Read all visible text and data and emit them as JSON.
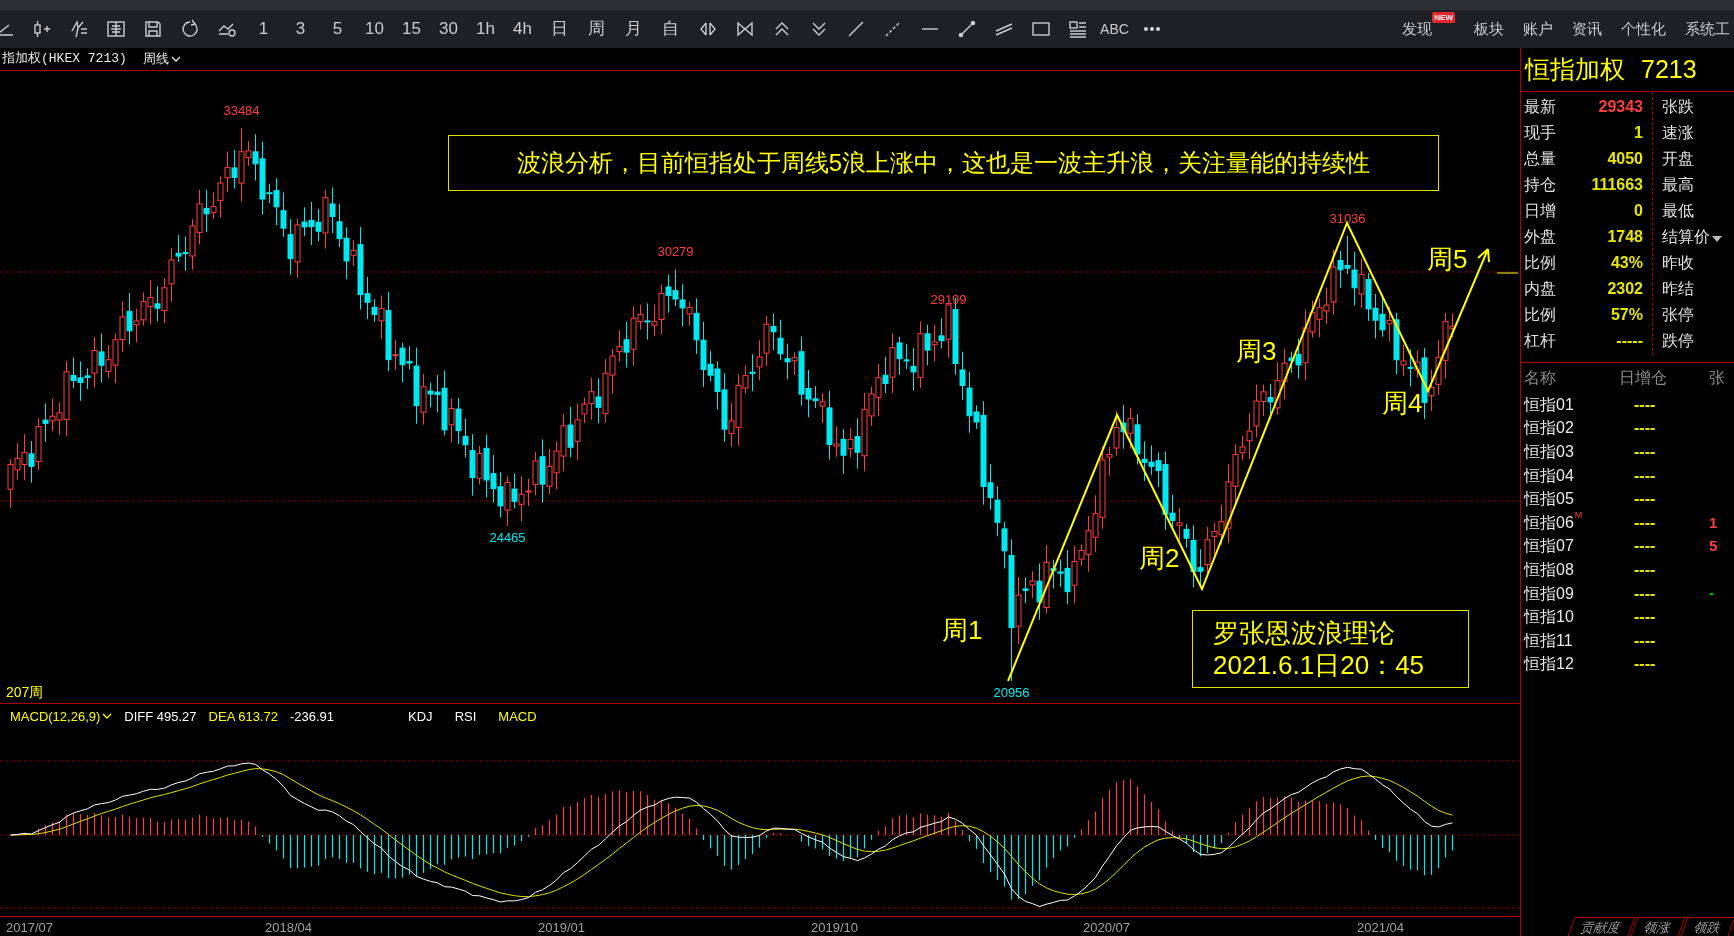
{
  "toolbar": {
    "periods": [
      {
        "label": "1",
        "selected": false
      },
      {
        "label": "3",
        "selected": false
      },
      {
        "label": "5",
        "selected": false
      },
      {
        "label": "10",
        "selected": false
      },
      {
        "label": "15",
        "selected": false
      },
      {
        "label": "30",
        "selected": false
      },
      {
        "label": "1h",
        "selected": false
      },
      {
        "label": "4h",
        "selected": false
      },
      {
        "label": "日",
        "selected": false
      },
      {
        "label": "周",
        "selected": false
      },
      {
        "label": "月",
        "selected": false
      },
      {
        "label": "自",
        "selected": false
      }
    ],
    "text_tool": "ABC",
    "nav": [
      {
        "label": "发现",
        "badge": "NEW"
      },
      {
        "label": "板块"
      },
      {
        "label": "账户"
      },
      {
        "label": "资讯"
      },
      {
        "label": "个性化"
      },
      {
        "label": "系统工"
      }
    ]
  },
  "chart_header": {
    "symbol": "指加权(HKEX 7213)",
    "period": "周线"
  },
  "main_chart": {
    "banner": "波浪分析，目前恒指处于周线5浪上涨中，这也是一波主升浪，关注量能的持续性",
    "price_labels": [
      {
        "text": "33484",
        "kind": "high"
      },
      {
        "text": "24465",
        "kind": "low"
      },
      {
        "text": "30279",
        "kind": "high"
      },
      {
        "text": "29199",
        "kind": "high"
      },
      {
        "text": "20956",
        "kind": "low"
      },
      {
        "text": "31036",
        "kind": "high"
      }
    ],
    "wave_labels": [
      "周1",
      "周2",
      "周3",
      "周4",
      "周5"
    ],
    "note": [
      "罗张恩波浪理论",
      "2021.6.1日20：45"
    ],
    "bar_count": "207周"
  },
  "macd_pane": {
    "name": "MACD(12,26,9)",
    "diff": "DIFF 495.27",
    "dea": "DEA 613.72",
    "macd": "-236.91",
    "indicators": [
      {
        "label": "KDJ",
        "selected": false
      },
      {
        "label": "RSI",
        "selected": false
      },
      {
        "label": "MACD",
        "selected": true
      }
    ]
  },
  "date_axis": [
    "2017/07",
    "2018/04",
    "2019/01",
    "2019/10",
    "2020/07",
    "2021/04"
  ],
  "quote_panel": {
    "title": "恒指加权",
    "code": "7213",
    "rows": [
      {
        "label": "最新",
        "value": "29343",
        "kind": "price",
        "right_label": "张跌"
      },
      {
        "label": "现手",
        "value": "1",
        "kind": "plain",
        "right_label": "速涨"
      },
      {
        "label": "总量",
        "value": "4050",
        "kind": "plain",
        "right_label": "开盘"
      },
      {
        "label": "持仓",
        "value": "111663",
        "kind": "plain",
        "right_label": "最高"
      },
      {
        "label": "日增",
        "value": "0",
        "kind": "plain",
        "right_label": "最低"
      },
      {
        "label": "外盘",
        "value": "1748",
        "kind": "plain",
        "right_label": "结算价"
      },
      {
        "label": "比例",
        "value": "43%",
        "kind": "plain",
        "right_label": "昨收"
      },
      {
        "label": "内盘",
        "value": "2302",
        "kind": "plain",
        "right_label": "昨结"
      },
      {
        "label": "比例",
        "value": "57%",
        "kind": "plain",
        "right_label": "张停"
      },
      {
        "label": "杠杆",
        "value": "-----",
        "kind": "plain",
        "right_label": "跌停"
      }
    ]
  },
  "contract_list": {
    "columns": [
      "名称",
      "日增仓",
      "张"
    ],
    "rows": [
      {
        "name": "恒指01",
        "change": "----"
      },
      {
        "name": "恒指02",
        "change": "----"
      },
      {
        "name": "恒指03",
        "change": "----"
      },
      {
        "name": "恒指04",
        "change": "----"
      },
      {
        "name": "恒指05",
        "change": "----"
      },
      {
        "name": "恒指06",
        "mark": "M",
        "change": "----",
        "column_3": "1",
        "color": "#ff3b3b"
      },
      {
        "name": "恒指07",
        "change": "----",
        "column_3": "5",
        "color": "#ff3b3b"
      },
      {
        "name": "恒指08",
        "change": "----"
      },
      {
        "name": "恒指09",
        "change": "----",
        "column_3": "-",
        "color": "#00d000"
      },
      {
        "name": "恒指10",
        "change": "----"
      },
      {
        "name": "恒指11",
        "change": "----"
      },
      {
        "name": "恒指12",
        "change": "----"
      }
    ]
  },
  "bottom_tabs": [
    {
      "label": "贡献度",
      "selected": false
    },
    {
      "label": "领涨",
      "selected": false
    },
    {
      "label": "领跌",
      "selected": false
    }
  ]
}
